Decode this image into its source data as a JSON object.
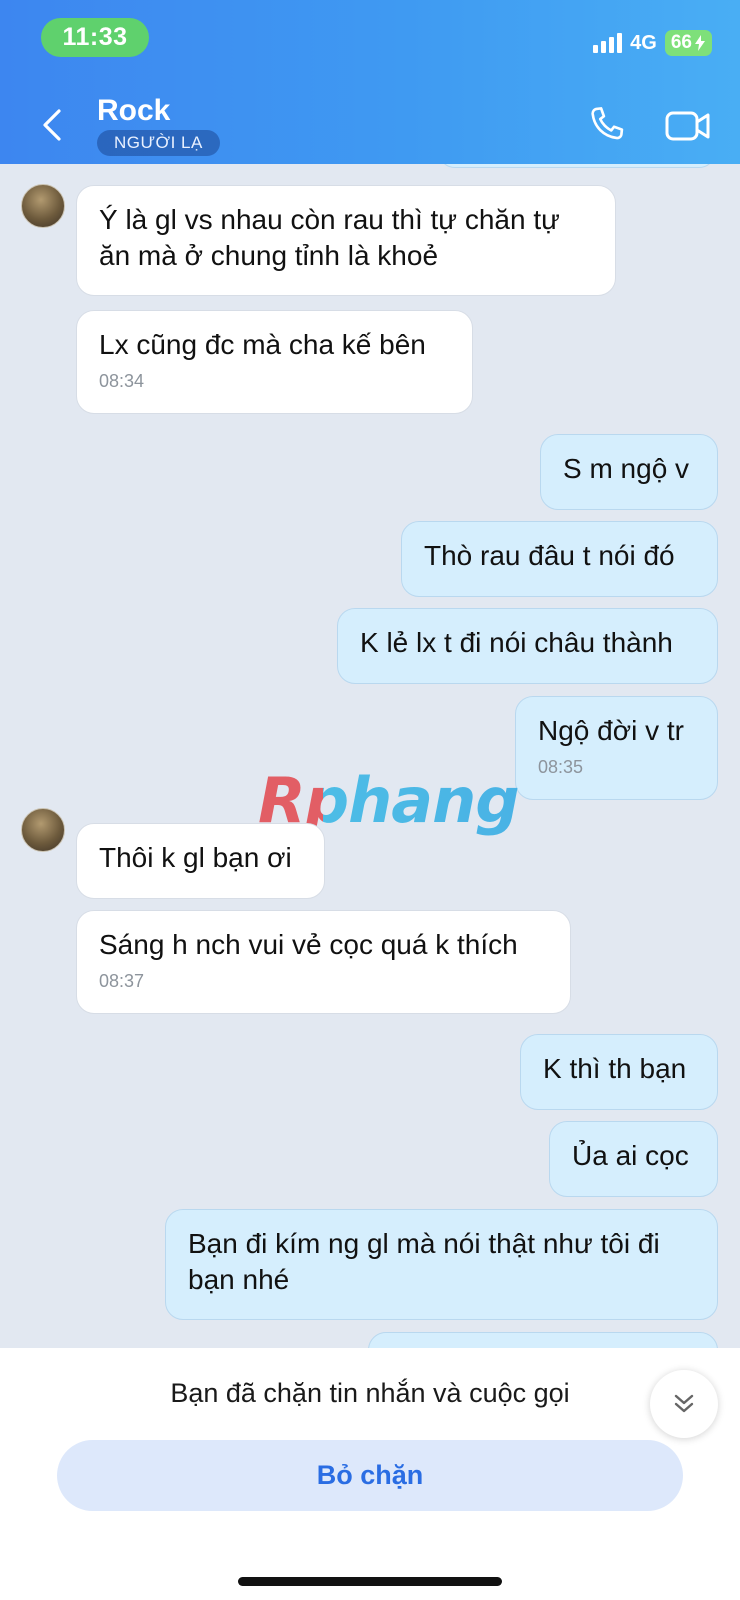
{
  "status_bar": {
    "time": "11:33",
    "network": "4G",
    "battery": "66"
  },
  "header": {
    "contact_name": "Rock",
    "badge": "NGƯỜI LẠ"
  },
  "messages": [
    {
      "side": "recv",
      "text": "Ý là gl vs nhau còn rau thì tự chăn tự ăn mà ở chung tỉnh là khoẻ"
    },
    {
      "side": "recv",
      "text": "Lx cũng đc mà cha kế bên",
      "time": "08:34"
    },
    {
      "side": "sent",
      "text": "S m ngộ v"
    },
    {
      "side": "sent",
      "text": "Thò rau đâu t nói đó"
    },
    {
      "side": "sent",
      "text": "K lẻ lx t đi nói châu thành"
    },
    {
      "side": "sent",
      "text": "Ngộ đời v tr",
      "time": "08:35"
    },
    {
      "side": "recv",
      "text": "Thôi k gl bạn ơi"
    },
    {
      "side": "recv",
      "text": "Sáng h nch vui vẻ cọc quá k thích",
      "time": "08:37"
    },
    {
      "side": "sent",
      "text": "K thì th bạn"
    },
    {
      "side": "sent",
      "text": "Ủa ai cọc"
    },
    {
      "side": "sent",
      "text": "Bạn đi kím ng gl mà nói thật như tôi đi bạn nhé"
    }
  ],
  "watermark": "Rphang",
  "bottom": {
    "blocked_notice": "Bạn đã chặn tin nhắn và cuộc gọi",
    "unblock_label": "Bỏ chặn"
  },
  "icons": {
    "back": "chevron-left-icon",
    "call": "phone-icon",
    "video": "video-camera-icon",
    "scroll": "double-chevron-down-icon"
  },
  "colors": {
    "header_start": "#3d86f0",
    "header_end": "#49aef4",
    "sent_bubble": "#d5eefd",
    "received_bubble": "#ffffff",
    "chat_background": "#e2e8f1",
    "unblock_text": "#2a6de3",
    "unblock_background": "#dde8fb"
  }
}
